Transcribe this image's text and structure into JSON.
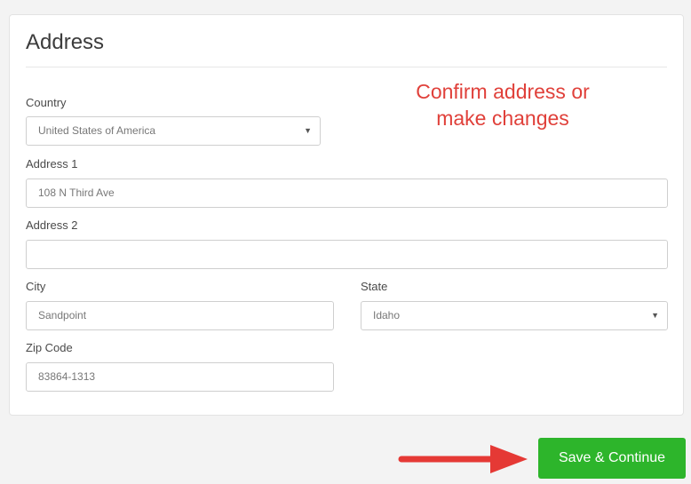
{
  "form": {
    "title": "Address",
    "annotation_line1": "Confirm address or",
    "annotation_line2": "make changes",
    "country": {
      "label": "Country",
      "value": "United States of America"
    },
    "address1": {
      "label": "Address 1",
      "value": "108 N Third Ave"
    },
    "address2": {
      "label": "Address 2",
      "value": ""
    },
    "city": {
      "label": "City",
      "value": "Sandpoint"
    },
    "state": {
      "label": "State",
      "value": "Idaho"
    },
    "zip": {
      "label": "Zip Code",
      "value": "83864-1313"
    }
  },
  "actions": {
    "save_label": "Save & Continue"
  },
  "icons": {
    "select_caret": "caret-down-icon",
    "pointer": "arrow-right-icon"
  },
  "colors": {
    "annotation": "#e0403a",
    "save_button": "#2db52b",
    "arrow": "#e53935"
  }
}
